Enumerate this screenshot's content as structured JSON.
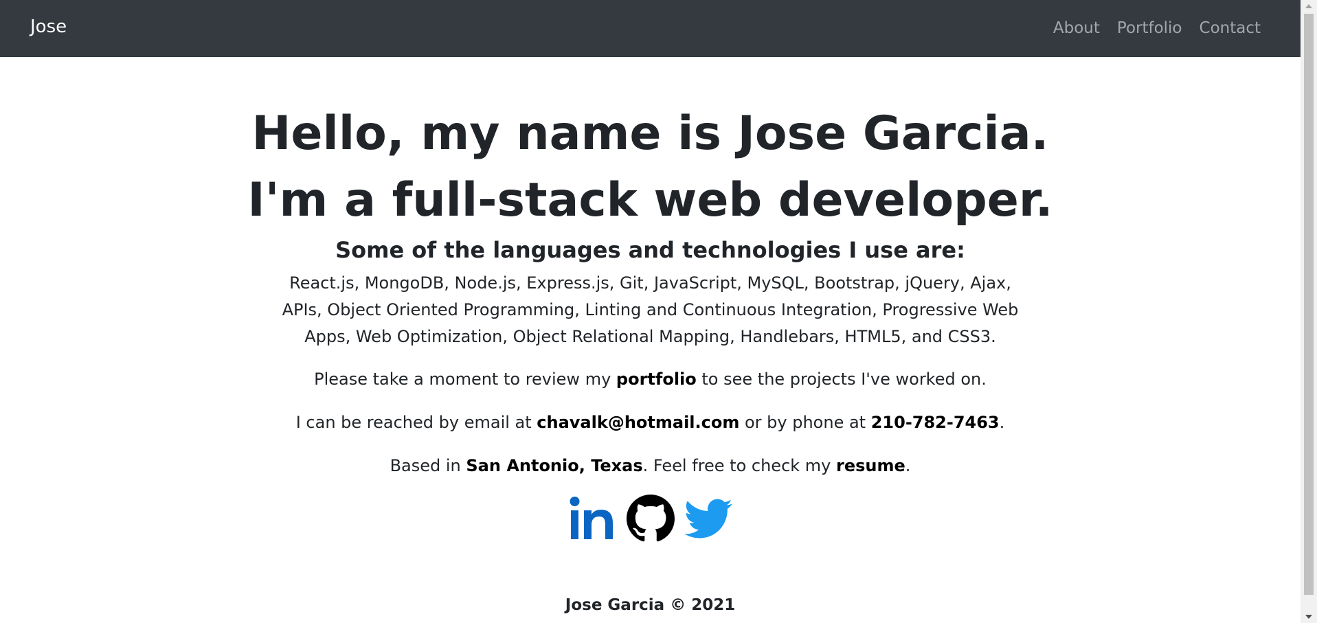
{
  "navbar": {
    "brand": "Jose",
    "links": [
      "About",
      "Portfolio",
      "Contact"
    ]
  },
  "hero": {
    "line1": "Hello, my name is Jose Garcia.",
    "line2": "I'm a full-stack web developer.",
    "subheading": "Some of the languages and technologies I use are:",
    "technologies": "React.js, MongoDB, Node.js, Express.js, Git, JavaScript, MySQL, Bootstrap, jQuery, Ajax, APIs, Object Oriented Programming, Linting and Continuous Integration, Progressive Web Apps, Web Optimization, Object Relational Mapping, Handlebars, HTML5, and CSS3."
  },
  "portfolio_line": {
    "before": "Please take a moment to review my ",
    "link": "portfolio",
    "after": " to see the projects I've worked on."
  },
  "contact_line": {
    "before": "I can be reached by email at ",
    "email": "chavalk@hotmail.com",
    "middle": " or by phone at ",
    "phone": "210-782-7463",
    "after": "."
  },
  "location_line": {
    "before": "Based in ",
    "location": "San Antonio, Texas",
    "middle": ". Feel free to check my ",
    "link": "resume",
    "after": "."
  },
  "socials": [
    {
      "name": "linkedin-icon",
      "color": "#0a66c2"
    },
    {
      "name": "github-icon",
      "color": "#000000"
    },
    {
      "name": "twitter-icon",
      "color": "#1d9bf0"
    }
  ],
  "footer": "Jose Garcia © 2021"
}
